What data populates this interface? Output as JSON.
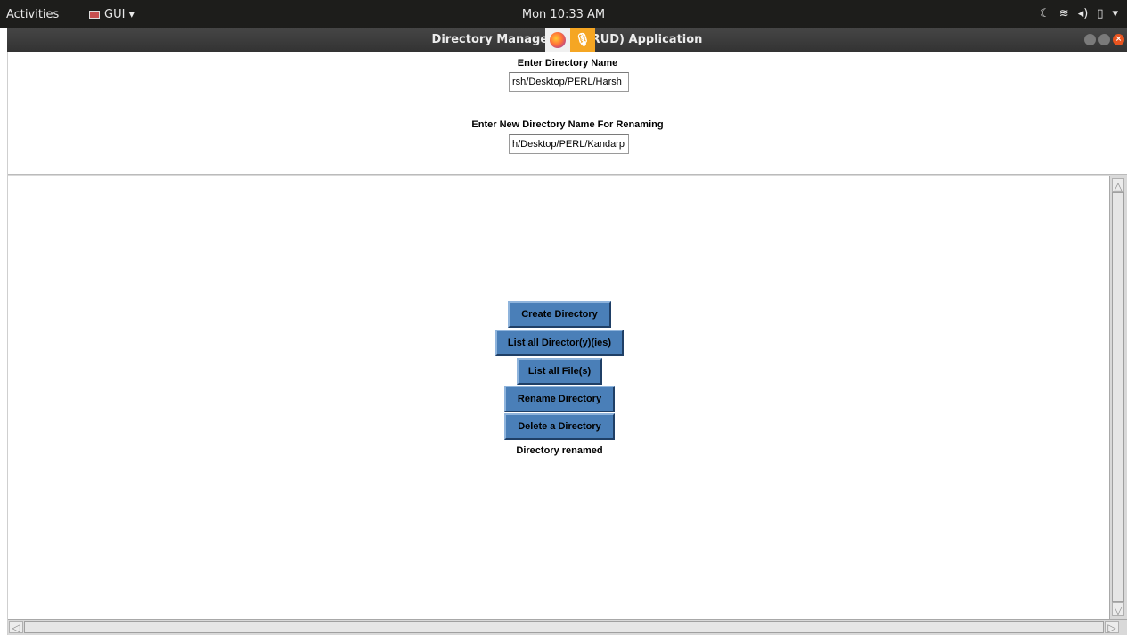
{
  "system_bar": {
    "activities": "Activities",
    "app_menu": "GUI ▾",
    "clock": "Mon 10:33 AM",
    "tray_icons": [
      "night-light-icon",
      "wifi-icon",
      "volume-icon",
      "battery-icon",
      "chevron-down-icon"
    ]
  },
  "window": {
    "title": "Directory Manage   CRUD) Application"
  },
  "form": {
    "dir_label": "Enter Directory Name",
    "dir_value": "rsh/Desktop/PERL/Harsh",
    "rename_label": "Enter New Directory Name For Renaming",
    "rename_value": "h/Desktop/PERL/Kandarp"
  },
  "buttons": {
    "create": "Create Directory",
    "list_dirs": "List all Director(y)(ies)",
    "list_files": "List all File(s)",
    "rename": "Rename Directory",
    "delete": "Delete a Directory"
  },
  "status": "Directory renamed",
  "colors": {
    "button_bg": "#4a7fb8",
    "top_bar": "#1d1d1b",
    "close_button": "#e9541f"
  }
}
